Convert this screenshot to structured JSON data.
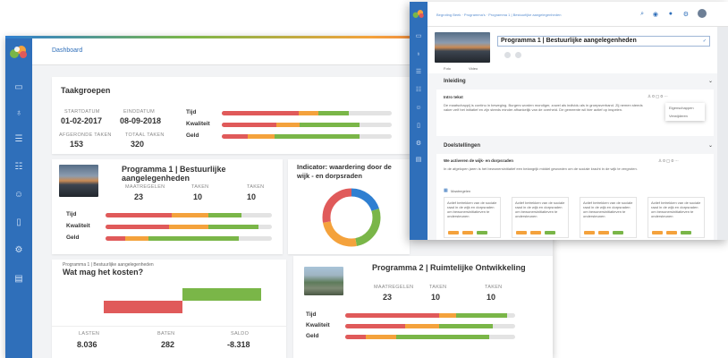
{
  "dashboard": {
    "breadcrumb": "Dashboard",
    "taakgroepen": {
      "title": "Taakgroepen",
      "startdatum_label": "STARTDATUM",
      "startdatum": "01-02-2017",
      "einddatum_label": "EINDDATUM",
      "einddatum": "08-09-2018",
      "afgeronde_label": "AFGERONDE TAKEN",
      "afgeronde": "153",
      "totaal_label": "TOTAAL TAKEN",
      "totaal": "320",
      "bars": [
        {
          "label": "Tijd",
          "red": 0.45,
          "orange": 0.12,
          "green": 0.18
        },
        {
          "label": "Kwaliteit",
          "red": 0.32,
          "orange": 0.14,
          "green": 0.35
        },
        {
          "label": "Geld",
          "red": 0.15,
          "orange": 0.16,
          "green": 0.5
        }
      ]
    },
    "programma1": {
      "title": "Programma 1 | Bestuurlijke aangelegenheden",
      "maatregelen_label": "MAATREGELEN",
      "maatregelen": "23",
      "taken_label": "TAKEN",
      "taken": "10",
      "taken2_label": "TAKEN",
      "taken2": "10",
      "bars": [
        {
          "label": "Tijd",
          "red": 0.4,
          "orange": 0.22,
          "green": 0.2
        },
        {
          "label": "Kwaliteit",
          "red": 0.38,
          "orange": 0.24,
          "green": 0.3
        },
        {
          "label": "Geld",
          "red": 0.12,
          "orange": 0.14,
          "green": 0.54
        }
      ]
    },
    "indicator": {
      "title": "Indicator: waardering door de wijk - en dorpsraden",
      "donut": [
        {
          "color": "#2f7fd1",
          "value": 0.2
        },
        {
          "color": "#7ab648",
          "value": 0.27
        },
        {
          "color": "#f4a23c",
          "value": 0.25
        },
        {
          "color": "#e05a5a",
          "value": 0.28
        }
      ]
    },
    "kosten": {
      "subtitle": "Programma 1 | Bestuurlijke aangelegenheden",
      "title": "Wat mag het kosten?",
      "lasten_label": "LASTEN",
      "lasten": "8.036",
      "baten_label": "BATEN",
      "baten": "282",
      "saldo_label": "SALDO",
      "saldo": "-8.318"
    },
    "programma2": {
      "title": "Programma 2 | Ruimtelijke Ontwikkeling",
      "maatregelen_label": "MAATREGELEN",
      "maatregelen": "23",
      "taken_label": "TAKEN",
      "taken": "10",
      "taken2_label": "TAKEN",
      "taken2": "10",
      "bars": [
        {
          "label": "Tijd",
          "red": 0.55,
          "orange": 0.1,
          "green": 0.3
        },
        {
          "label": "Kwaliteit",
          "red": 0.35,
          "orange": 0.2,
          "green": 0.32
        },
        {
          "label": "Geld",
          "red": 0.12,
          "orange": 0.18,
          "green": 0.55
        }
      ]
    }
  },
  "detail": {
    "breadcrumb": "Begroting Beek · Programma's · Programma 1 | Bestuurlijke aangelegenheden",
    "title": "Programma 1 | Bestuurlijke aangelegenheden",
    "tab_foto": "Foto",
    "tab_video": "Video",
    "inleiding_title": "Inleiding",
    "intro_label": "Intro tekst",
    "intro_text": "De maatschappij is continu in beweging. Burgers worden mondiger, zowel als individu als in groepsverband. Zij nemen steeds vaker zelf het initiatief en zijn steeds minder afhankelijk van de overheid. De gemeente wil hier actief op inspelen.",
    "menu_eigenschappen": "Eigenschappen",
    "menu_verwijderen": "Verwijderen",
    "doelstellingen_title": "Doelstellingen",
    "doel_label": "We activeren de wijk- en dorpsraden",
    "doel_text": "In de afgelopen jaren is het bewonersinitiatief een belangrijk middel geworden om de sociale kracht in de wijk te vergroten.",
    "maatregelen_label": "Maatregelen",
    "measure_text": "Actief betrekken van de sociale raad in de wijk en dorpsraden om bewonersinitiatieven te ondersteunen",
    "measures": [
      "m1",
      "m2",
      "m3",
      "m4"
    ]
  }
}
